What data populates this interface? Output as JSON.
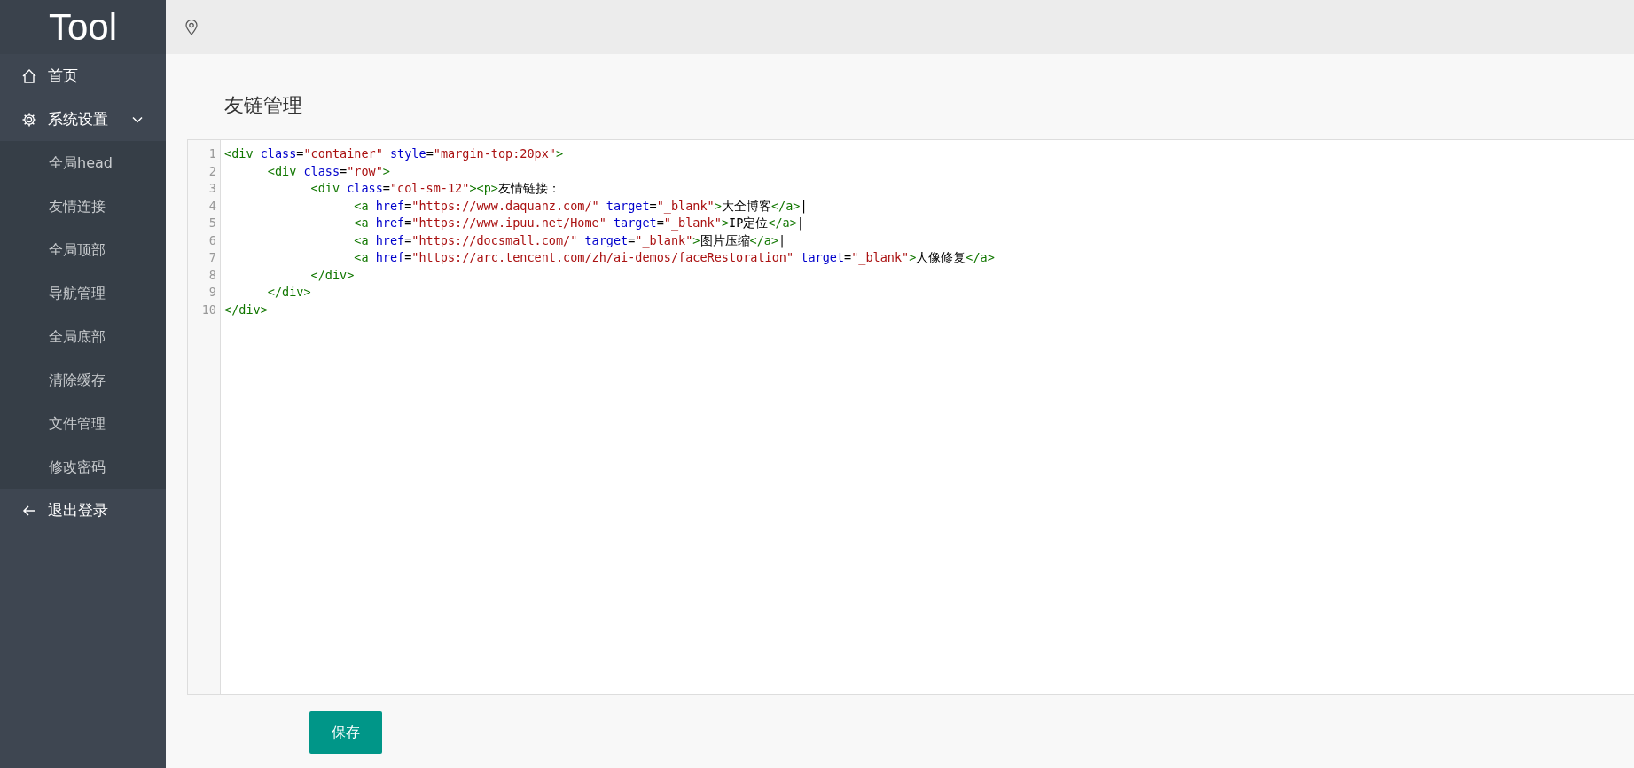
{
  "sidebar": {
    "logo": "Tool",
    "items": [
      {
        "label": "首页"
      },
      {
        "label": "系统设置",
        "expanded": true,
        "children": [
          {
            "label": "全局head"
          },
          {
            "label": "友情连接"
          },
          {
            "label": "全局顶部"
          },
          {
            "label": "导航管理"
          },
          {
            "label": "全局底部"
          },
          {
            "label": "清除缓存"
          },
          {
            "label": "文件管理"
          },
          {
            "label": "修改密码"
          }
        ]
      },
      {
        "label": "退出登录"
      }
    ]
  },
  "page": {
    "title": "友链管理"
  },
  "editor": {
    "lines": [
      {
        "number": "1",
        "tokens": [
          {
            "kind": "tag",
            "text": "<div"
          },
          {
            "kind": "attr",
            "text": " class"
          },
          {
            "kind": "text",
            "text": "="
          },
          {
            "kind": "string",
            "text": "\"container\""
          },
          {
            "kind": "attr",
            "text": " style"
          },
          {
            "kind": "text",
            "text": "="
          },
          {
            "kind": "string",
            "text": "\"margin-top:20px\""
          },
          {
            "kind": "tag",
            "text": ">"
          }
        ]
      },
      {
        "number": "2",
        "tokens": [
          {
            "kind": "tag",
            "text": "      <div"
          },
          {
            "kind": "attr",
            "text": " class"
          },
          {
            "kind": "text",
            "text": "="
          },
          {
            "kind": "string",
            "text": "\"row\""
          },
          {
            "kind": "tag",
            "text": ">"
          }
        ]
      },
      {
        "number": "3",
        "tokens": [
          {
            "kind": "tag",
            "text": "            <div"
          },
          {
            "kind": "attr",
            "text": " class"
          },
          {
            "kind": "text",
            "text": "="
          },
          {
            "kind": "string",
            "text": "\"col-sm-12\""
          },
          {
            "kind": "tag",
            "text": "><p>"
          },
          {
            "kind": "text",
            "text": "友情链接："
          }
        ]
      },
      {
        "number": "4",
        "tokens": [
          {
            "kind": "tag",
            "text": "                  <a"
          },
          {
            "kind": "attr",
            "text": " href"
          },
          {
            "kind": "text",
            "text": "="
          },
          {
            "kind": "string",
            "text": "\"https://www.daquanz.com/\""
          },
          {
            "kind": "attr",
            "text": " target"
          },
          {
            "kind": "text",
            "text": "="
          },
          {
            "kind": "string",
            "text": "\"_blank\""
          },
          {
            "kind": "tag",
            "text": ">"
          },
          {
            "kind": "text",
            "text": "大全博客"
          },
          {
            "kind": "tag",
            "text": "</a>"
          },
          {
            "kind": "text",
            "text": "|"
          }
        ]
      },
      {
        "number": "5",
        "tokens": [
          {
            "kind": "tag",
            "text": "                  <a"
          },
          {
            "kind": "attr",
            "text": " href"
          },
          {
            "kind": "text",
            "text": "="
          },
          {
            "kind": "string",
            "text": "\"https://www.ipuu.net/Home\""
          },
          {
            "kind": "attr",
            "text": " target"
          },
          {
            "kind": "text",
            "text": "="
          },
          {
            "kind": "string",
            "text": "\"_blank\""
          },
          {
            "kind": "tag",
            "text": ">"
          },
          {
            "kind": "text",
            "text": "IP定位"
          },
          {
            "kind": "tag",
            "text": "</a>"
          },
          {
            "kind": "text",
            "text": "|"
          }
        ]
      },
      {
        "number": "6",
        "tokens": [
          {
            "kind": "tag",
            "text": "                  <a"
          },
          {
            "kind": "attr",
            "text": " href"
          },
          {
            "kind": "text",
            "text": "="
          },
          {
            "kind": "string",
            "text": "\"https://docsmall.com/\""
          },
          {
            "kind": "attr",
            "text": " target"
          },
          {
            "kind": "text",
            "text": "="
          },
          {
            "kind": "string",
            "text": "\"_blank\""
          },
          {
            "kind": "tag",
            "text": ">"
          },
          {
            "kind": "text",
            "text": "图片压缩"
          },
          {
            "kind": "tag",
            "text": "</a>"
          },
          {
            "kind": "text",
            "text": "|"
          }
        ]
      },
      {
        "number": "7",
        "tokens": [
          {
            "kind": "tag",
            "text": "                  <a"
          },
          {
            "kind": "attr",
            "text": " href"
          },
          {
            "kind": "text",
            "text": "="
          },
          {
            "kind": "string",
            "text": "\"https://arc.tencent.com/zh/ai-demos/faceRestoration\""
          },
          {
            "kind": "attr",
            "text": " target"
          },
          {
            "kind": "text",
            "text": "="
          },
          {
            "kind": "string",
            "text": "\"_blank\""
          },
          {
            "kind": "tag",
            "text": ">"
          },
          {
            "kind": "text",
            "text": "人像修复"
          },
          {
            "kind": "tag",
            "text": "</a>"
          }
        ]
      },
      {
        "number": "8",
        "tokens": [
          {
            "kind": "tag",
            "text": "            </div>"
          }
        ]
      },
      {
        "number": "9",
        "tokens": [
          {
            "kind": "tag",
            "text": "      </div>"
          }
        ]
      },
      {
        "number": "10",
        "tokens": [
          {
            "kind": "tag",
            "text": "</div>"
          }
        ]
      }
    ]
  },
  "save_button": "保存"
}
